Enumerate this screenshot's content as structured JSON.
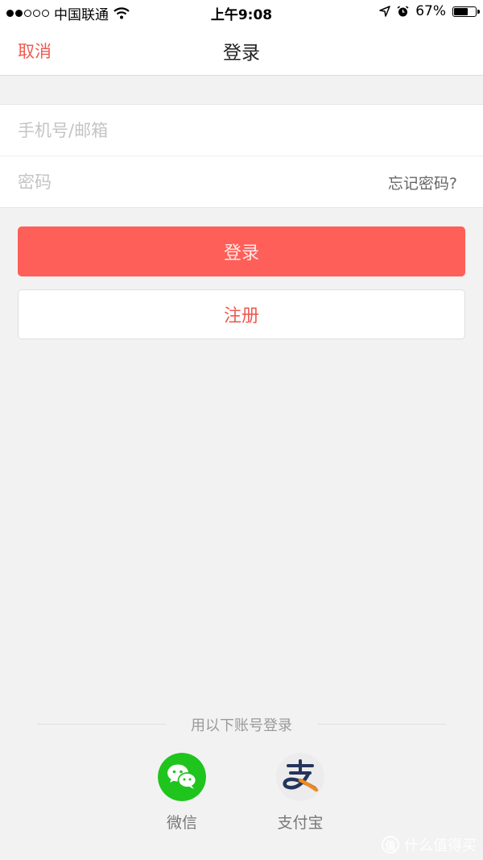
{
  "status_bar": {
    "carrier": "中国联通",
    "time": "上午9:08",
    "battery": "67%",
    "battery_level": 0.67
  },
  "nav": {
    "cancel": "取消",
    "title": "登录"
  },
  "form": {
    "phone_placeholder": "手机号/邮箱",
    "password_placeholder": "密码",
    "forgot": "忘记密码?"
  },
  "buttons": {
    "login": "登录",
    "register": "注册"
  },
  "third_party": {
    "title": "用以下账号登录",
    "wechat": "微信",
    "alipay": "支付宝"
  },
  "watermark": {
    "text": "什么值得买",
    "badge": "值"
  },
  "colors": {
    "accent": "#fe5f58",
    "wechat_green": "#1fc41d",
    "alipay_orange": "#f08a1f"
  }
}
